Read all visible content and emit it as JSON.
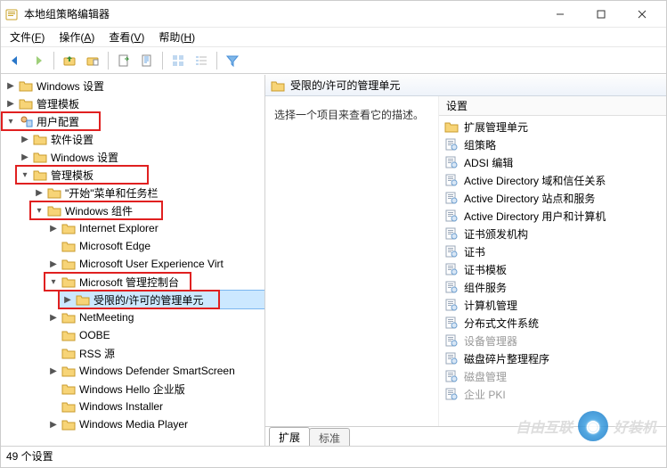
{
  "window": {
    "title": "本地组策略编辑器",
    "minimize": "min",
    "maximize": "max",
    "close": "close"
  },
  "menubar": [
    {
      "label": "文件",
      "hotkey": "F"
    },
    {
      "label": "操作",
      "hotkey": "A"
    },
    {
      "label": "查看",
      "hotkey": "V"
    },
    {
      "label": "帮助",
      "hotkey": "H"
    }
  ],
  "toolbar_icons": [
    "back",
    "forward",
    "sep",
    "folder-up",
    "properties",
    "sep",
    "export",
    "refresh",
    "sep",
    "details",
    "list",
    "sep",
    "filter"
  ],
  "tree": {
    "windows_settings": "Windows 设置",
    "admin_templates_top": "管理模板",
    "user_config": "用户配置",
    "software_settings": "软件设置",
    "windows_settings2": "Windows 设置",
    "admin_templates": "管理模板",
    "start_taskbar": "\"开始\"菜单和任务栏",
    "win_components": "Windows 组件",
    "ie": "Internet Explorer",
    "edge": "Microsoft Edge",
    "ux_virt": "Microsoft User Experience Virt",
    "mmc": "Microsoft 管理控制台",
    "restricted": "受限的/许可的管理单元",
    "netmeeting": "NetMeeting",
    "oobe": "OOBE",
    "rss": "RSS 源",
    "defender": "Windows Defender SmartScreen",
    "hello": "Windows Hello 企业版",
    "installer": "Windows Installer",
    "media_player": "Windows Media Player"
  },
  "detail": {
    "header_title": "受限的/许可的管理单元",
    "prompt": "选择一个项目来查看它的描述。",
    "col_header": "设置"
  },
  "list_items": [
    {
      "type": "folder",
      "label": "扩展管理单元"
    },
    {
      "type": "policy",
      "label": "组策略"
    },
    {
      "type": "policy",
      "label": "ADSI 编辑"
    },
    {
      "type": "policy",
      "label": "Active Directory 域和信任关系"
    },
    {
      "type": "policy",
      "label": "Active Directory 站点和服务"
    },
    {
      "type": "policy",
      "label": "Active Directory 用户和计算机"
    },
    {
      "type": "policy",
      "label": "证书颁发机构"
    },
    {
      "type": "policy",
      "label": "证书"
    },
    {
      "type": "policy",
      "label": "证书模板"
    },
    {
      "type": "policy",
      "label": "组件服务"
    },
    {
      "type": "policy",
      "label": "计算机管理"
    },
    {
      "type": "policy",
      "label": "分布式文件系统"
    },
    {
      "type": "policy",
      "label": "设备管理器",
      "disabled": true
    },
    {
      "type": "policy",
      "label": "磁盘碎片整理程序"
    },
    {
      "type": "policy",
      "label": "磁盘管理",
      "disabled": true
    },
    {
      "type": "policy",
      "label": "企业 PKI",
      "disabled": true
    }
  ],
  "tabs": [
    {
      "label": "扩展",
      "active": true
    },
    {
      "label": "标准",
      "active": false
    }
  ],
  "statusbar": {
    "count_text": "49 个设置"
  },
  "watermark": {
    "text1": "自由互联",
    "text2": "好装机"
  }
}
